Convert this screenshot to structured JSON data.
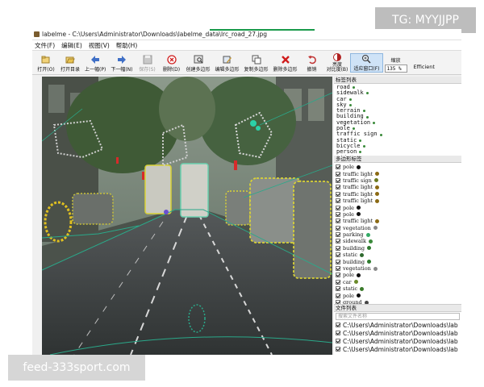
{
  "window": {
    "title": "labelme - C:\\Users\\Administrator\\Downloads\\labelme_data\\lrc_road_27.jpg",
    "icon": "labelme-icon"
  },
  "menu": [
    "文件(F)",
    "编辑(E)",
    "视图(V)",
    "帮助(H)"
  ],
  "toolbar": {
    "tools": [
      {
        "label": "打开(O)",
        "icon": "open-icon"
      },
      {
        "label": "打开目录",
        "icon": "open-dir-icon"
      },
      {
        "label": "上一幅(P)",
        "icon": "prev-icon"
      },
      {
        "label": "下一幅(N)",
        "icon": "next-icon"
      },
      {
        "label": "保存(S)",
        "icon": "save-icon"
      },
      {
        "label": "删除(D)",
        "icon": "delete-file-icon"
      },
      {
        "label": "创建多边形",
        "icon": "create-polygon-icon"
      },
      {
        "label": "编辑多边形",
        "icon": "edit-polygon-icon"
      },
      {
        "label": "复制多边形",
        "icon": "copy-polygon-icon"
      },
      {
        "label": "删除多边形",
        "icon": "delete-polygon-icon"
      },
      {
        "label": "撤销",
        "icon": "undo-icon"
      },
      {
        "label": "亮度\n对比度(B)",
        "icon": "brightness-icon"
      },
      {
        "label": "适应窗口(F)",
        "icon": "fit-window-icon"
      }
    ],
    "zoom_label": "缩放",
    "zoom_value": "135 %",
    "efficient": "Efficient"
  },
  "panels": {
    "labels_title": "标签列表",
    "labels": [
      {
        "text": "road",
        "color": "#3a8a3a"
      },
      {
        "text": "sidewalk",
        "color": "#3a8a3a"
      },
      {
        "text": "car",
        "color": "#3a8a3a"
      },
      {
        "text": "sky",
        "color": "#3a8a3a"
      },
      {
        "text": "terrain",
        "color": "#3a8a3a"
      },
      {
        "text": "building",
        "color": "#3a8a3a"
      },
      {
        "text": "vegetation",
        "color": "#3a8a3a"
      },
      {
        "text": "pole",
        "color": "#3a8a3a"
      },
      {
        "text": "traffic sign",
        "color": "#3a8a3a"
      },
      {
        "text": "static",
        "color": "#3a8a3a"
      },
      {
        "text": "bicycle",
        "color": "#3a8a3a"
      },
      {
        "text": "person",
        "color": "#3a8a3a"
      },
      {
        "text": "rider",
        "color": "#3a8a3a"
      }
    ],
    "polygons_title": "多边形标签",
    "polygons": [
      {
        "text": "pole",
        "color": "#111111"
      },
      {
        "text": "traffic light",
        "color": "#8b6a14"
      },
      {
        "text": "traffic sign",
        "color": "#6a7a20"
      },
      {
        "text": "traffic light",
        "color": "#8b6a14"
      },
      {
        "text": "traffic light",
        "color": "#8b6a14"
      },
      {
        "text": "traffic light",
        "color": "#8b6a14"
      },
      {
        "text": "pole",
        "color": "#111111"
      },
      {
        "text": "pole",
        "color": "#111111"
      },
      {
        "text": "traffic light",
        "color": "#8b6a14"
      },
      {
        "text": "vegetation",
        "color": "#888888"
      },
      {
        "text": "parking",
        "color": "#33aa66"
      },
      {
        "text": "sidewalk",
        "color": "#3a8a3a"
      },
      {
        "text": "building",
        "color": "#2f7a2f"
      },
      {
        "text": "static",
        "color": "#2f6a2f"
      },
      {
        "text": "building",
        "color": "#2f7a2f"
      },
      {
        "text": "vegetation",
        "color": "#888888"
      },
      {
        "text": "pole",
        "color": "#111111"
      },
      {
        "text": "car",
        "color": "#6a8a2a"
      },
      {
        "text": "static",
        "color": "#3a7a2a"
      },
      {
        "text": "pole",
        "color": "#111111"
      },
      {
        "text": "ground",
        "color": "#444444"
      }
    ],
    "files_title": "文件列表",
    "file_search_placeholder": "搜索文件名称",
    "files": [
      "C:\\Users\\Administrator\\Downloads\\lab",
      "C:\\Users\\Administrator\\Downloads\\lab",
      "C:\\Users\\Administrator\\Downloads\\lab",
      "C:\\Users\\Administrator\\Downloads\\lab"
    ]
  },
  "watermarks": {
    "top": "TG: MYYJJPP",
    "bottom": "feed-333sport.com"
  }
}
